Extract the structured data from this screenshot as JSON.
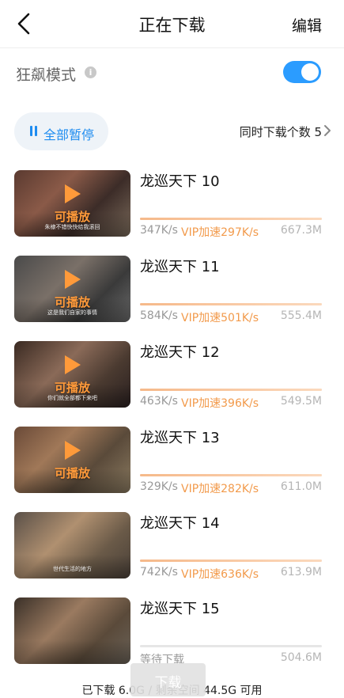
{
  "header": {
    "title": "正在下载",
    "edit_label": "编辑"
  },
  "mode": {
    "label": "狂飙模式",
    "info_icon": "info-icon",
    "enabled": true,
    "toggle_color": "#2b9cff"
  },
  "controls": {
    "pause_all_label": "全部暂停",
    "concurrent_label": "同时下载个数 5"
  },
  "downloads": [
    {
      "title": "龙巡天下 10",
      "playable": "可播放",
      "subtitle": "朱棣不错快快给我滚回",
      "progress": 1.0,
      "speed": "347K/s",
      "vip": "VIP加速297K/s",
      "size": "667.3M"
    },
    {
      "title": "龙巡天下 11",
      "playable": "可播放",
      "subtitle": "这是我们自家的事情",
      "progress": 1.0,
      "speed": "584K/s",
      "vip": "VIP加速501K/s",
      "size": "555.4M"
    },
    {
      "title": "龙巡天下 12",
      "playable": "可播放",
      "subtitle": "你们就全部都下来吧",
      "progress": 1.0,
      "speed": "463K/s",
      "vip": "VIP加速396K/s",
      "size": "549.5M"
    },
    {
      "title": "龙巡天下 13",
      "playable": "可播放",
      "subtitle": "",
      "progress": 1.0,
      "speed": "329K/s",
      "vip": "VIP加速282K/s",
      "size": "611.0M"
    },
    {
      "title": "龙巡天下 14",
      "playable": "",
      "subtitle": "世代生活的地方",
      "progress": 1.0,
      "speed": "742K/s",
      "vip": "VIP加速636K/s",
      "size": "613.9M"
    },
    {
      "title": "龙巡天下 15",
      "playable": "",
      "subtitle": "",
      "progress": 0.0,
      "status": "等待下载",
      "size": "504.6M"
    }
  ],
  "footer": {
    "download_label": "下载",
    "storage": "已下载 6.0G / 剩余空间 44.5G 可用"
  },
  "colors": {
    "accent": "#1e8cf0",
    "vip": "#f29a4b",
    "playable": "#ff9a3a"
  }
}
